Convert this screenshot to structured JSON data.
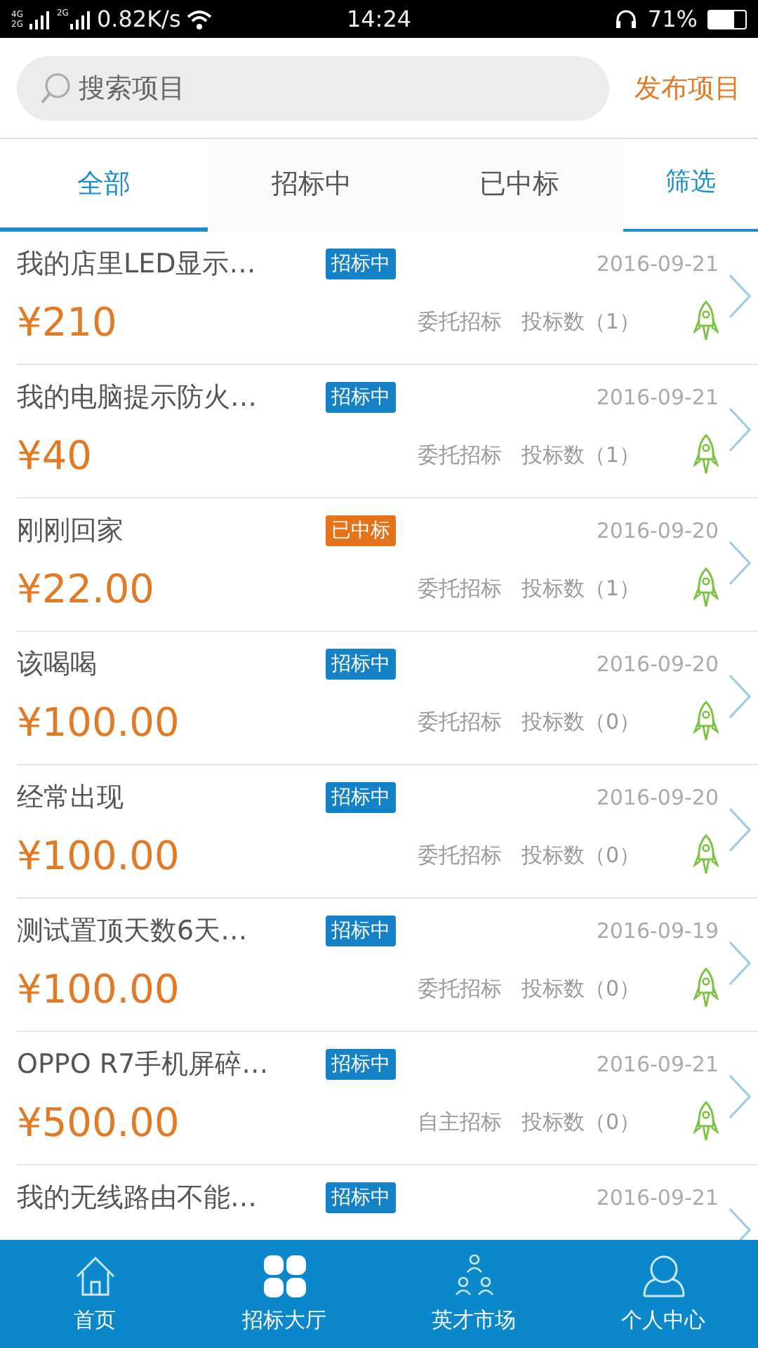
{
  "status_bar": {
    "networks": [
      "4G",
      "2G",
      "2G"
    ],
    "speed": "0.82K/s",
    "time": "14:24",
    "battery_text": "71%"
  },
  "header": {
    "search": {
      "placeholder": "搜索项目"
    },
    "publish": "发布项目"
  },
  "tabs": [
    {
      "label": "全部",
      "selected": true
    },
    {
      "label": "招标中",
      "selected": false
    },
    {
      "label": "已中标",
      "selected": false
    }
  ],
  "filter": "筛选",
  "projects": [
    {
      "title": "我的店里LED显示…",
      "status": {
        "label": "招标中",
        "kind": "bidding"
      },
      "date": "2016-09-21",
      "price": "¥210",
      "mode": "委托招标",
      "bids": "投标数（1）"
    },
    {
      "title": "我的电脑提示防火…",
      "status": {
        "label": "招标中",
        "kind": "bidding"
      },
      "date": "2016-09-21",
      "price": "¥40",
      "mode": "委托招标",
      "bids": "投标数（1）"
    },
    {
      "title": "刚刚回家",
      "status": {
        "label": "已中标",
        "kind": "won"
      },
      "date": "2016-09-20",
      "price": "¥22.00",
      "mode": "委托招标",
      "bids": "投标数（1）"
    },
    {
      "title": "该喝喝",
      "status": {
        "label": "招标中",
        "kind": "bidding"
      },
      "date": "2016-09-20",
      "price": "¥100.00",
      "mode": "委托招标",
      "bids": "投标数（0）"
    },
    {
      "title": "经常出现",
      "status": {
        "label": "招标中",
        "kind": "bidding"
      },
      "date": "2016-09-20",
      "price": "¥100.00",
      "mode": "委托招标",
      "bids": "投标数（0）"
    },
    {
      "title": "测试置顶天数6天…",
      "status": {
        "label": "招标中",
        "kind": "bidding"
      },
      "date": "2016-09-19",
      "price": "¥100.00",
      "mode": "委托招标",
      "bids": "投标数（0）"
    },
    {
      "title": "OPPO R7手机屏碎…",
      "status": {
        "label": "招标中",
        "kind": "bidding"
      },
      "date": "2016-09-21",
      "price": "¥500.00",
      "mode": "自主招标",
      "bids": "投标数（0）"
    },
    {
      "title": "我的无线路由不能…",
      "status": {
        "label": "招标中",
        "kind": "bidding"
      },
      "date": "2016-09-21"
    }
  ],
  "bottom_nav": [
    {
      "label": "首页",
      "kind": "home",
      "selected": false
    },
    {
      "label": "招标大厅",
      "kind": "hall",
      "selected": true
    },
    {
      "label": "英才市场",
      "kind": "talent",
      "selected": false
    },
    {
      "label": "个人中心",
      "kind": "profile",
      "selected": false
    }
  ]
}
